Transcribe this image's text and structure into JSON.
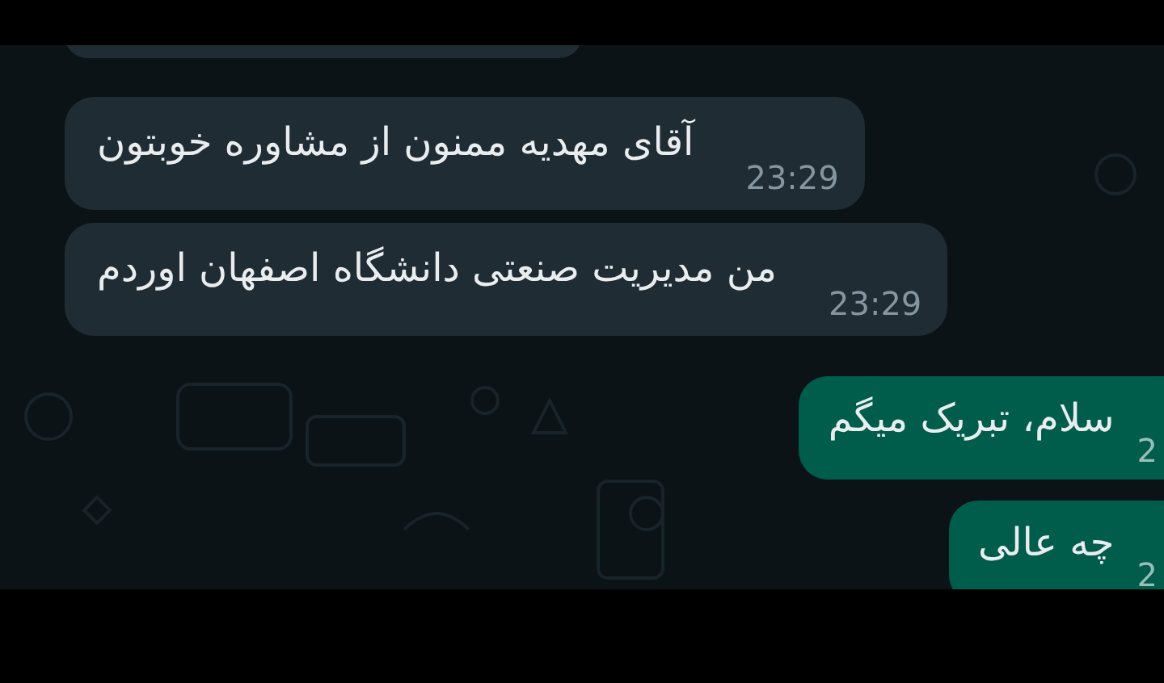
{
  "messages": [
    {
      "kind": "partial"
    },
    {
      "kind": "incoming",
      "text": "آقای مهدیه ممنون از مشاوره خوبتون",
      "time": "23:29"
    },
    {
      "kind": "incoming",
      "text": "من مدیریت صنعتی دانشگاه اصفهان اوردم",
      "time": "23:29"
    },
    {
      "kind": "outgoing",
      "text": "سلام، تبریک میگم",
      "time": "2"
    },
    {
      "kind": "outgoing",
      "text": "چه عالی",
      "time": "2"
    }
  ]
}
